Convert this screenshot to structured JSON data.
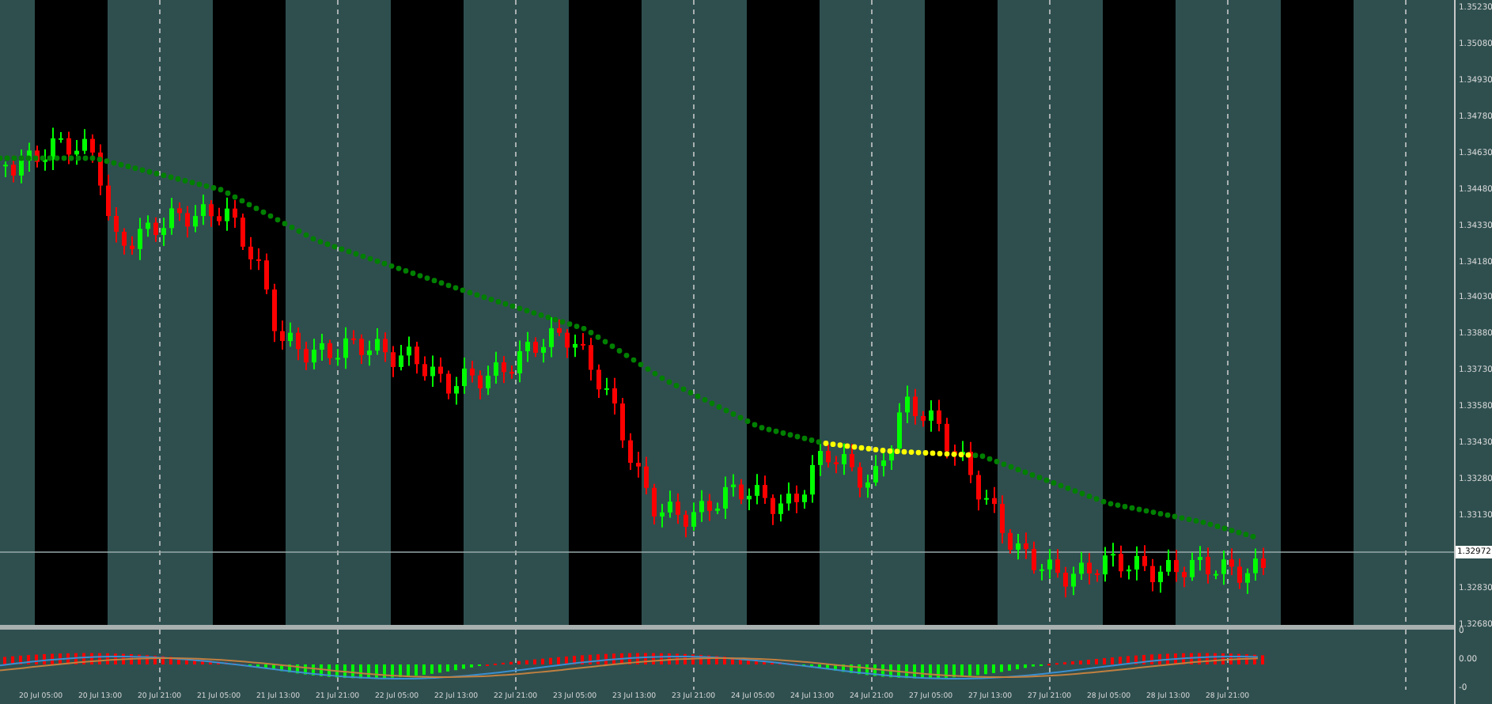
{
  "price_axis": {
    "labels": [
      "1.35230",
      "1.35080",
      "1.34930",
      "1.34780",
      "1.34630",
      "1.34480",
      "1.34330",
      "1.34180",
      "1.34030",
      "1.33880",
      "1.33730",
      "1.33580",
      "1.33430",
      "1.33280",
      "1.33130",
      "1.32830",
      "1.32680"
    ],
    "current_price": "1.32972"
  },
  "indicator_axis": {
    "labels": [
      "0",
      "0.00",
      "-0"
    ]
  },
  "time_axis": {
    "labels": [
      "20 Jul 05:00",
      "20 Jul 13:00",
      "20 Jul 21:00",
      "21 Jul 05:00",
      "21 Jul 13:00",
      "21 Jul 21:00",
      "22 Jul 05:00",
      "22 Jul 13:00",
      "22 Jul 21:00",
      "23 Jul 05:00",
      "23 Jul 13:00",
      "23 Jul 21:00",
      "24 Jul 05:00",
      "24 Jul 13:00",
      "24 Jul 21:00",
      "27 Jul 05:00",
      "27 Jul 13:00",
      "27 Jul 21:00",
      "28 Jul 05:00",
      "28 Jul 13:00",
      "28 Jul 21:00"
    ]
  }
}
